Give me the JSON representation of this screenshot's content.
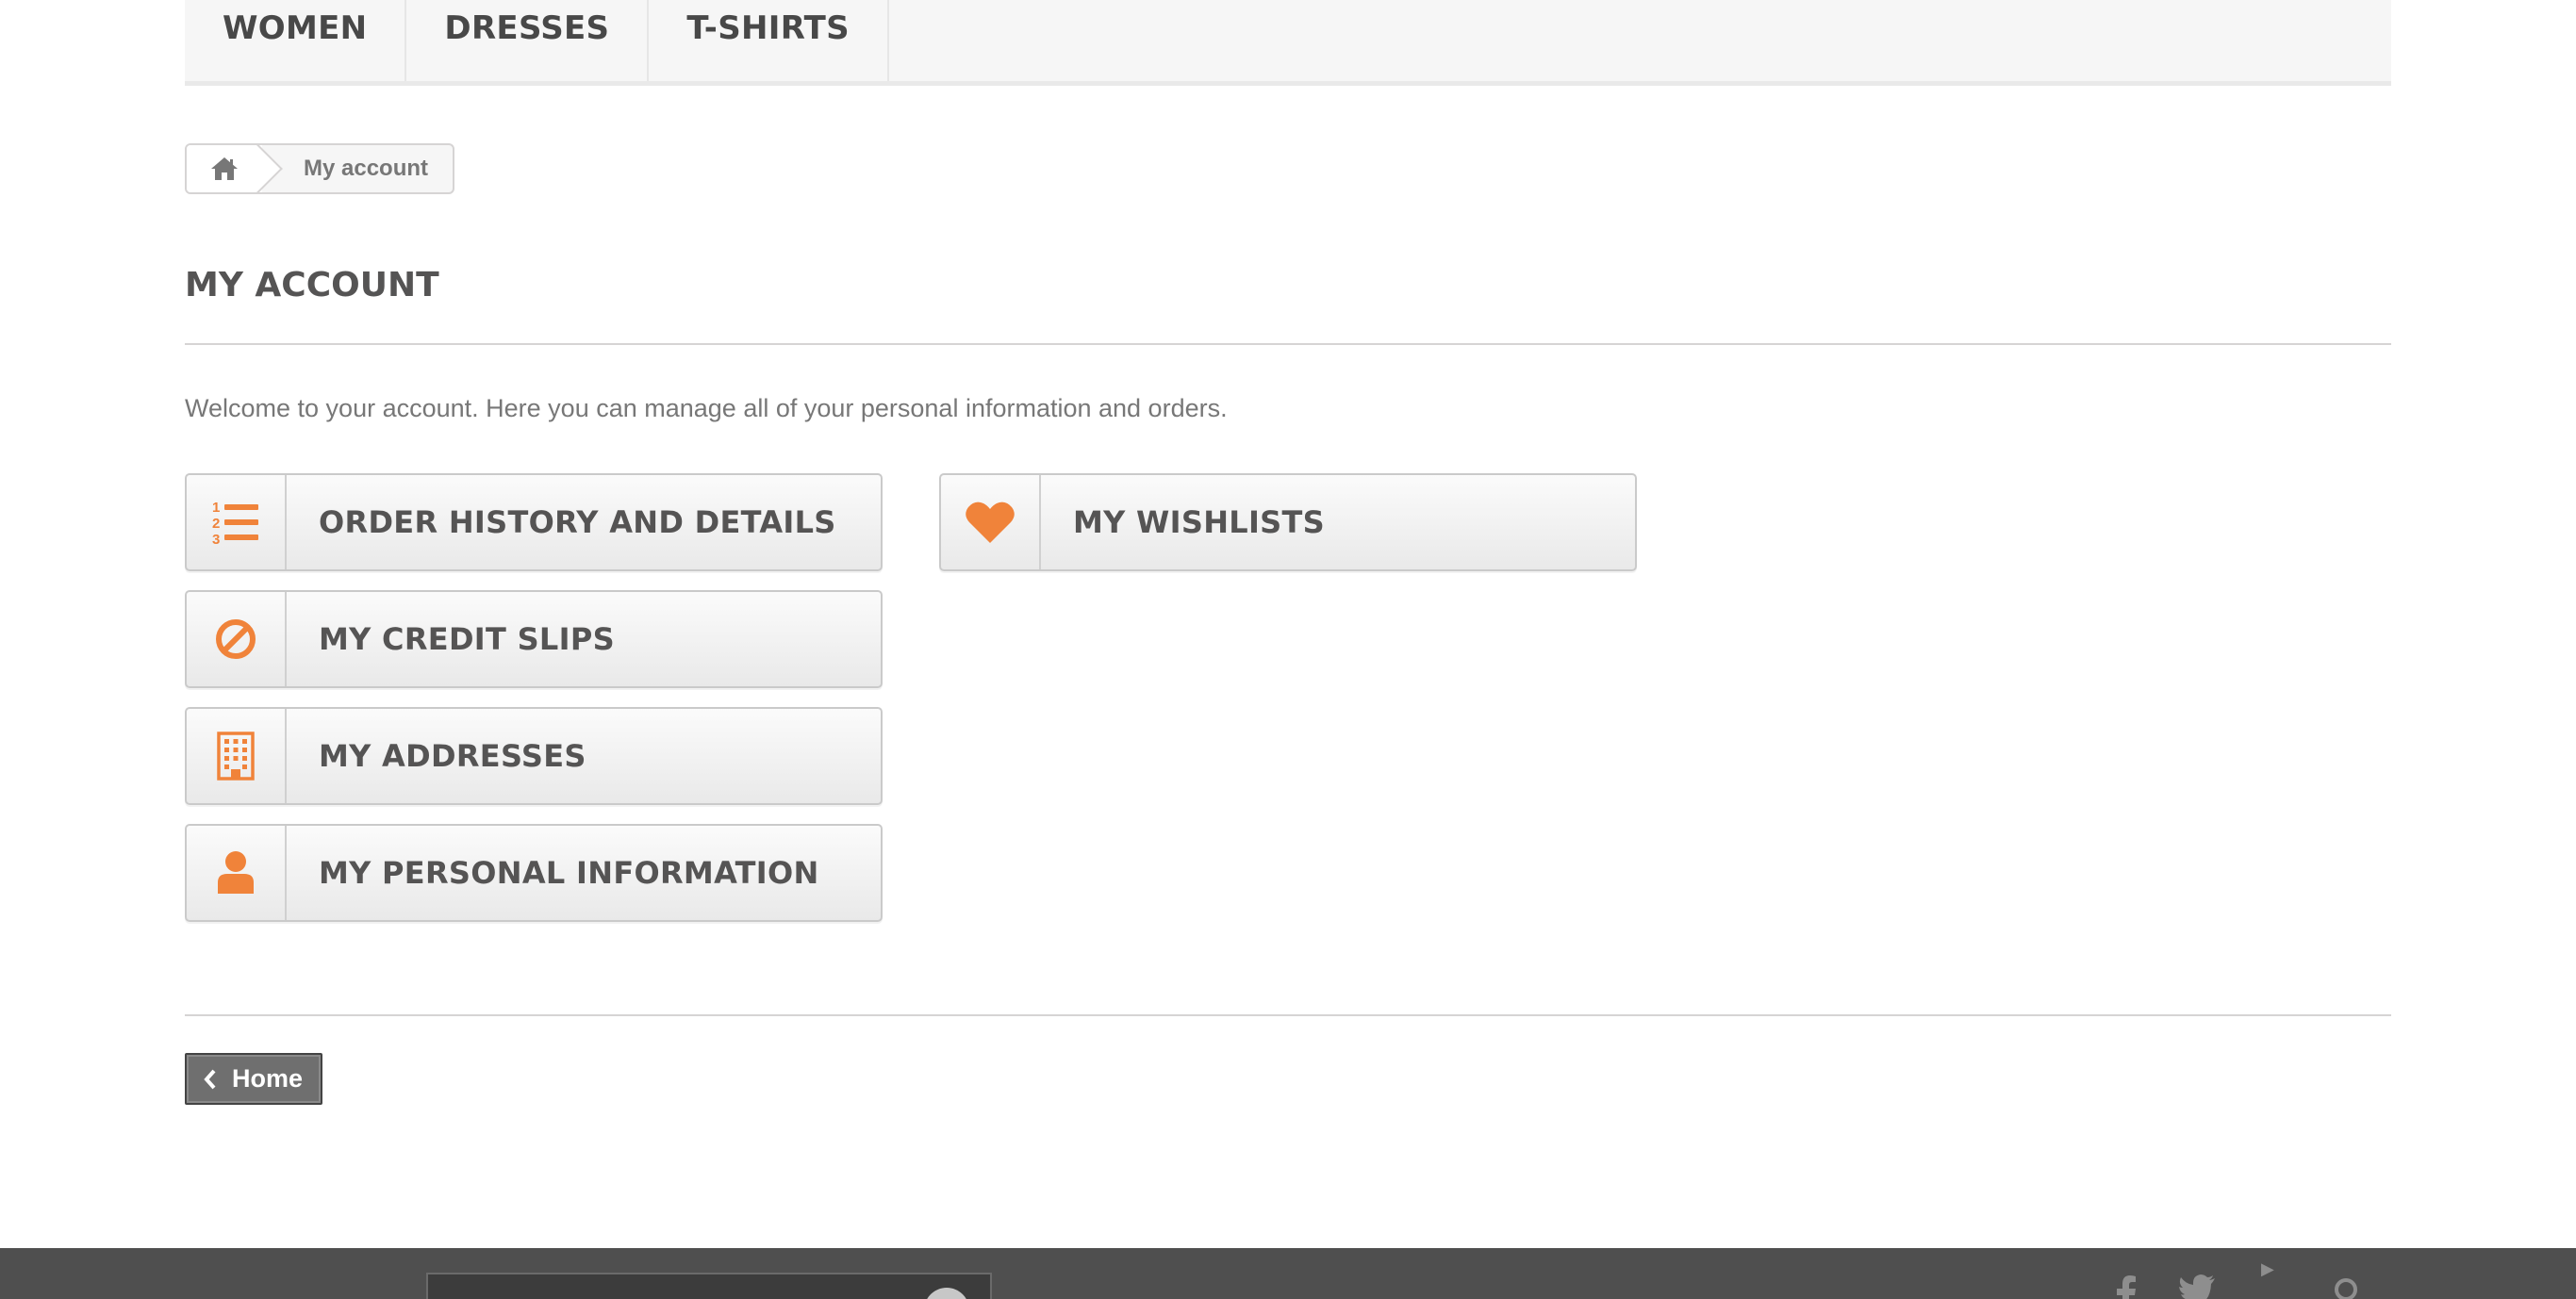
{
  "menu": {
    "items": [
      {
        "label": "WOMEN"
      },
      {
        "label": "DRESSES"
      },
      {
        "label": "T-SHIRTS"
      }
    ]
  },
  "breadcrumb": {
    "home_icon": "home-icon",
    "current": "My account"
  },
  "page": {
    "title": "MY ACCOUNT",
    "welcome": "Welcome to your account. Here you can manage all of your personal information and orders."
  },
  "account_links": {
    "order_history": {
      "label": "ORDER HISTORY AND DETAILS",
      "icon": "ordered-list-icon"
    },
    "credit_slips": {
      "label": "MY CREDIT SLIPS",
      "icon": "ban-icon"
    },
    "addresses": {
      "label": "MY ADDRESSES",
      "icon": "building-icon"
    },
    "personal_info": {
      "label": "MY PERSONAL INFORMATION",
      "icon": "user-icon"
    },
    "wishlists": {
      "label": "MY WISHLISTS",
      "icon": "heart-icon"
    }
  },
  "home_button": {
    "label": "Home",
    "icon": "chevron-left-icon"
  },
  "colors": {
    "accent": "#f0833a",
    "footer_bg": "#4f4f4f",
    "menu_bg": "#f6f6f6"
  }
}
